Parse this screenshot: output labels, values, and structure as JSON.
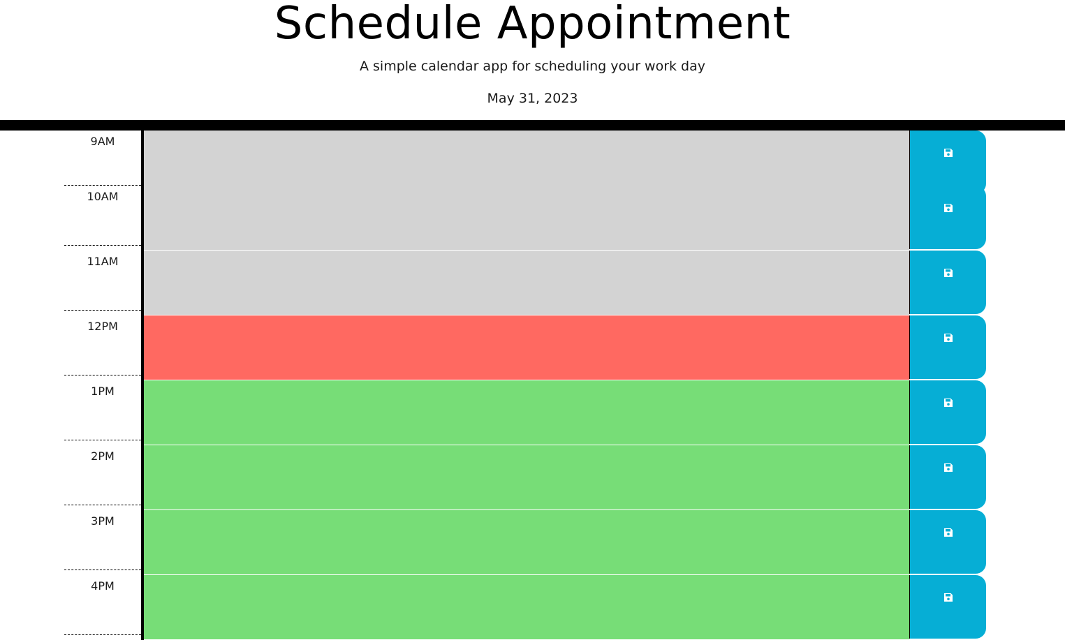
{
  "header": {
    "title": "Schedule Appointment",
    "subtitle": "A simple calendar app for scheduling your work day",
    "date": "May 31, 2023"
  },
  "colors": {
    "past": "#d3d3d3",
    "present": "#ff6961",
    "future": "#77dd77",
    "save_button": "#06aed5"
  },
  "timeblocks": [
    {
      "hour": "9AM",
      "state": "past",
      "text": ""
    },
    {
      "hour": "10AM",
      "state": "past",
      "text": ""
    },
    {
      "hour": "11AM",
      "state": "past",
      "text": ""
    },
    {
      "hour": "12PM",
      "state": "present",
      "text": ""
    },
    {
      "hour": "1PM",
      "state": "future",
      "text": ""
    },
    {
      "hour": "2PM",
      "state": "future",
      "text": ""
    },
    {
      "hour": "3PM",
      "state": "future",
      "text": ""
    },
    {
      "hour": "4PM",
      "state": "future",
      "text": ""
    }
  ],
  "icons": {
    "save": "floppy-disk-icon"
  }
}
